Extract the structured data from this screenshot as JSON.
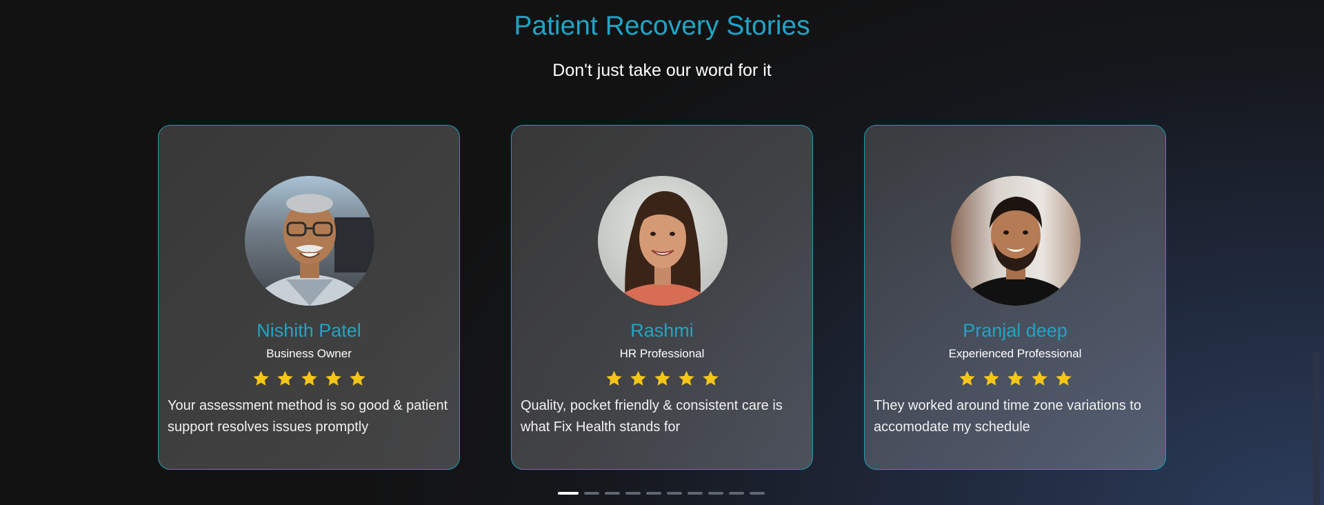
{
  "section": {
    "title": "Patient Recovery Stories",
    "subtitle": "Don't just take our word for it"
  },
  "colors": {
    "accent": "#1fa5c6",
    "star": "#f5c518",
    "card_border": "#1f9bb4"
  },
  "testimonials": [
    {
      "name": "Nishith Patel",
      "role": "Business Owner",
      "rating": 5,
      "quote": "Your assessment method is so good & patient support resolves issues promptly"
    },
    {
      "name": "Rashmi",
      "role": "HR Professional",
      "rating": 5,
      "quote": "Quality, pocket friendly & consistent care is what Fix Health stands for"
    },
    {
      "name": "Pranjal deep",
      "role": "Experienced Professional",
      "rating": 5,
      "quote": "They worked around time zone variations to accomodate my schedule"
    }
  ],
  "carousel": {
    "total_pages": 10,
    "active_page": 1
  }
}
